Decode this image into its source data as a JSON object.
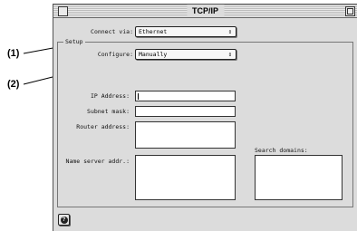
{
  "window": {
    "title": "TCP/IP"
  },
  "callouts": {
    "one": "(1)",
    "two": "(2)"
  },
  "connect": {
    "label": "Connect via:",
    "value": "Ethernet"
  },
  "setup": {
    "group_label": "Setup",
    "configure_label": "Configure:",
    "configure_value": "Manually",
    "ip_label": "IP Address:",
    "subnet_label": "Subnet mask:",
    "router_label": "Router address:",
    "nameserver_label": "Name server addr.:",
    "search_label": "Search domains:"
  },
  "icons": {
    "popup_arrow": "⇕",
    "help": "?"
  }
}
